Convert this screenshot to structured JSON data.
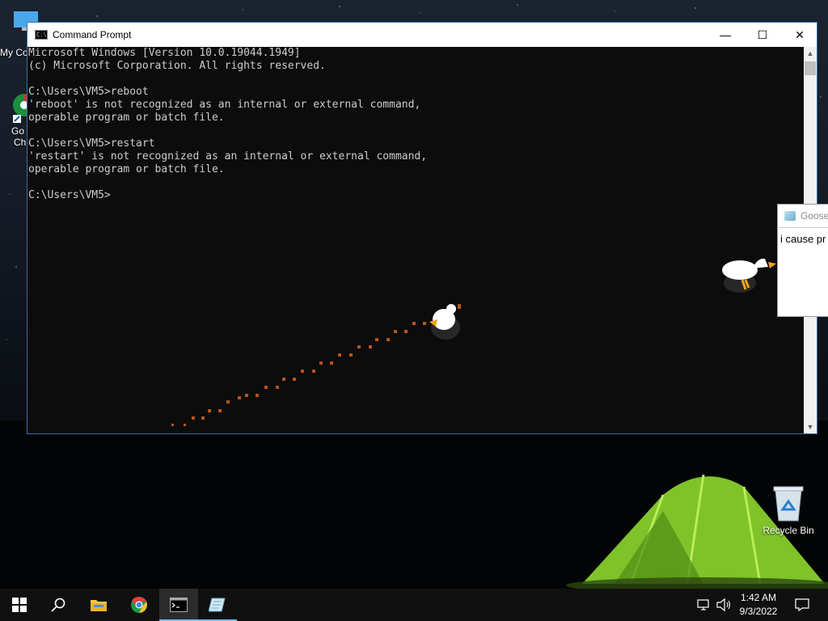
{
  "desktop": {
    "icons": [
      {
        "label": "My Co",
        "icon": "this-pc-icon"
      },
      {
        "label": "Go",
        "label2": "Ch",
        "icon": "chrome-shortcut-icon"
      },
      {
        "label": "Recycle Bin",
        "icon": "recycle-bin-icon"
      }
    ]
  },
  "cmd_window": {
    "title": "Command Prompt",
    "controls": {
      "minimize": "—",
      "maximize": "☐",
      "close": "✕"
    },
    "lines": [
      "Microsoft Windows [Version 10.0.19044.1949]",
      "(c) Microsoft Corporation. All rights reserved.",
      "",
      "C:\\Users\\VM5>reboot",
      "'reboot' is not recognized as an internal or external command,",
      "operable program or batch file.",
      "",
      "C:\\Users\\VM5>restart",
      "'restart' is not recognized as an internal or external command,",
      "operable program or batch file.",
      "",
      "C:\\Users\\VM5>"
    ]
  },
  "goose_window": {
    "title": "Goose",
    "text": "i cause pr"
  },
  "taskbar": {
    "items": [
      {
        "name": "start-button",
        "icon": "windows-logo-icon"
      },
      {
        "name": "search-button",
        "icon": "search-icon"
      },
      {
        "name": "file-explorer-button",
        "icon": "folder-icon"
      },
      {
        "name": "chrome-button",
        "icon": "chrome-icon"
      },
      {
        "name": "cmd-button",
        "icon": "cmd-icon",
        "active": true
      },
      {
        "name": "notepad-button",
        "icon": "notepad-icon"
      }
    ],
    "clock": {
      "time": "1:42 AM",
      "date": "9/3/2022"
    }
  },
  "colors": {
    "console_bg": "#0c0c0c",
    "console_text": "#cccccc",
    "taskbar_bg": "#101010",
    "accent": "#76b9ed",
    "goose_footprint": "#b5541c"
  }
}
